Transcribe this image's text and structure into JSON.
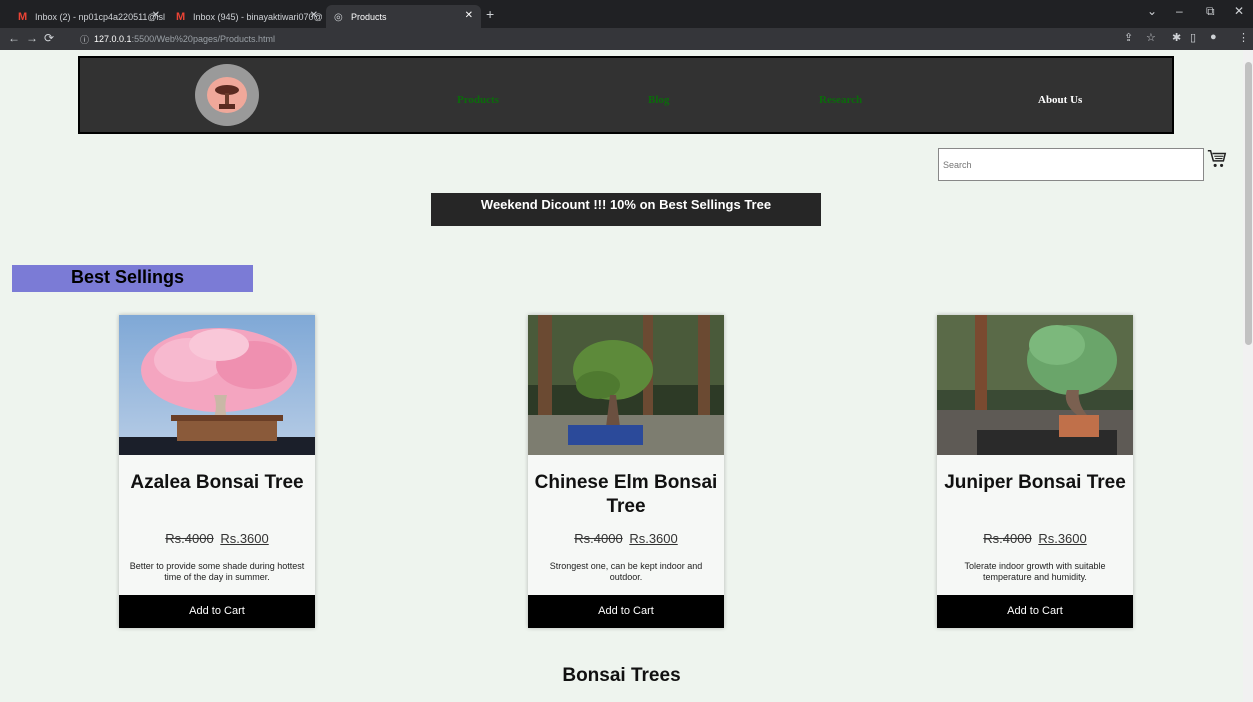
{
  "browser": {
    "tabs": [
      {
        "title": "Inbox (2) - np01cp4a220511@isl"
      },
      {
        "title": "Inbox (945) - binayaktiwari070@"
      },
      {
        "title": "Products"
      }
    ],
    "address": {
      "host": "127.0.0.1",
      "path": ":5500/Web%20pages/Products.html"
    }
  },
  "nav": {
    "links": [
      "Products",
      "Blog",
      "Research",
      "About Us"
    ]
  },
  "search": {
    "placeholder": "Search"
  },
  "promo": {
    "text": "Weekend Dicount !!! 10% on Best Sellings Tree"
  },
  "best": {
    "heading": "Best Sellings"
  },
  "products": [
    {
      "name": "Azalea Bonsai Tree",
      "old_price": "Rs.4000",
      "new_price": "Rs.3600",
      "description": "Better to provide some shade during hottest time of the day in summer.",
      "button": "Add to Cart"
    },
    {
      "name": "Chinese Elm Bonsai Tree",
      "old_price": "Rs.4000",
      "new_price": "Rs.3600",
      "description": "Strongest one, can be kept indoor and outdoor.",
      "button": "Add to Cart"
    },
    {
      "name": "Juniper Bonsai Tree",
      "old_price": "Rs.4000",
      "new_price": "Rs.3600",
      "description": "Tolerate indoor growth with suitable temperature and humidity.",
      "button": "Add to Cart"
    }
  ],
  "section": {
    "heading": "Bonsai Trees"
  }
}
